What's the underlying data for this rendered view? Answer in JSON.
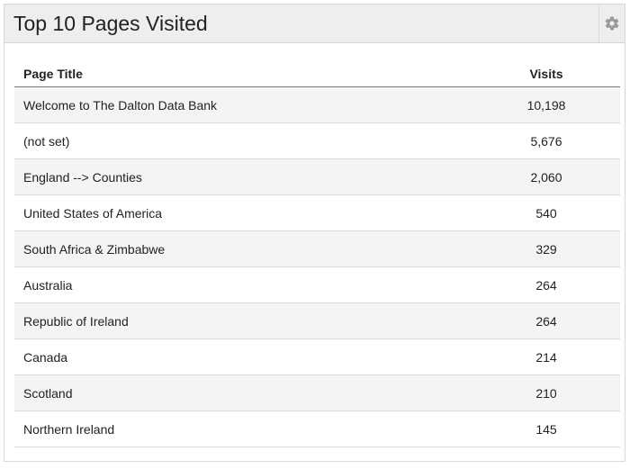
{
  "widget": {
    "title": "Top 10 Pages Visited",
    "settings_icon": "gear-icon"
  },
  "table": {
    "headers": {
      "page_title": "Page Title",
      "visits": "Visits"
    },
    "rows": [
      {
        "title": "Welcome to The Dalton Data Bank",
        "visits": "10,198"
      },
      {
        "title": "(not set)",
        "visits": "5,676"
      },
      {
        "title": "England --> Counties",
        "visits": "2,060"
      },
      {
        "title": "United States of America",
        "visits": "540"
      },
      {
        "title": "South Africa & Zimbabwe",
        "visits": "329"
      },
      {
        "title": "Australia",
        "visits": "264"
      },
      {
        "title": "Republic of Ireland",
        "visits": "264"
      },
      {
        "title": "Canada",
        "visits": "214"
      },
      {
        "title": "Scotland",
        "visits": "210"
      },
      {
        "title": "Northern Ireland",
        "visits": "145"
      }
    ]
  },
  "colors": {
    "header_bg": "#eeeeee",
    "row_alt_bg": "#f4f4f4",
    "gear": "#999999"
  }
}
